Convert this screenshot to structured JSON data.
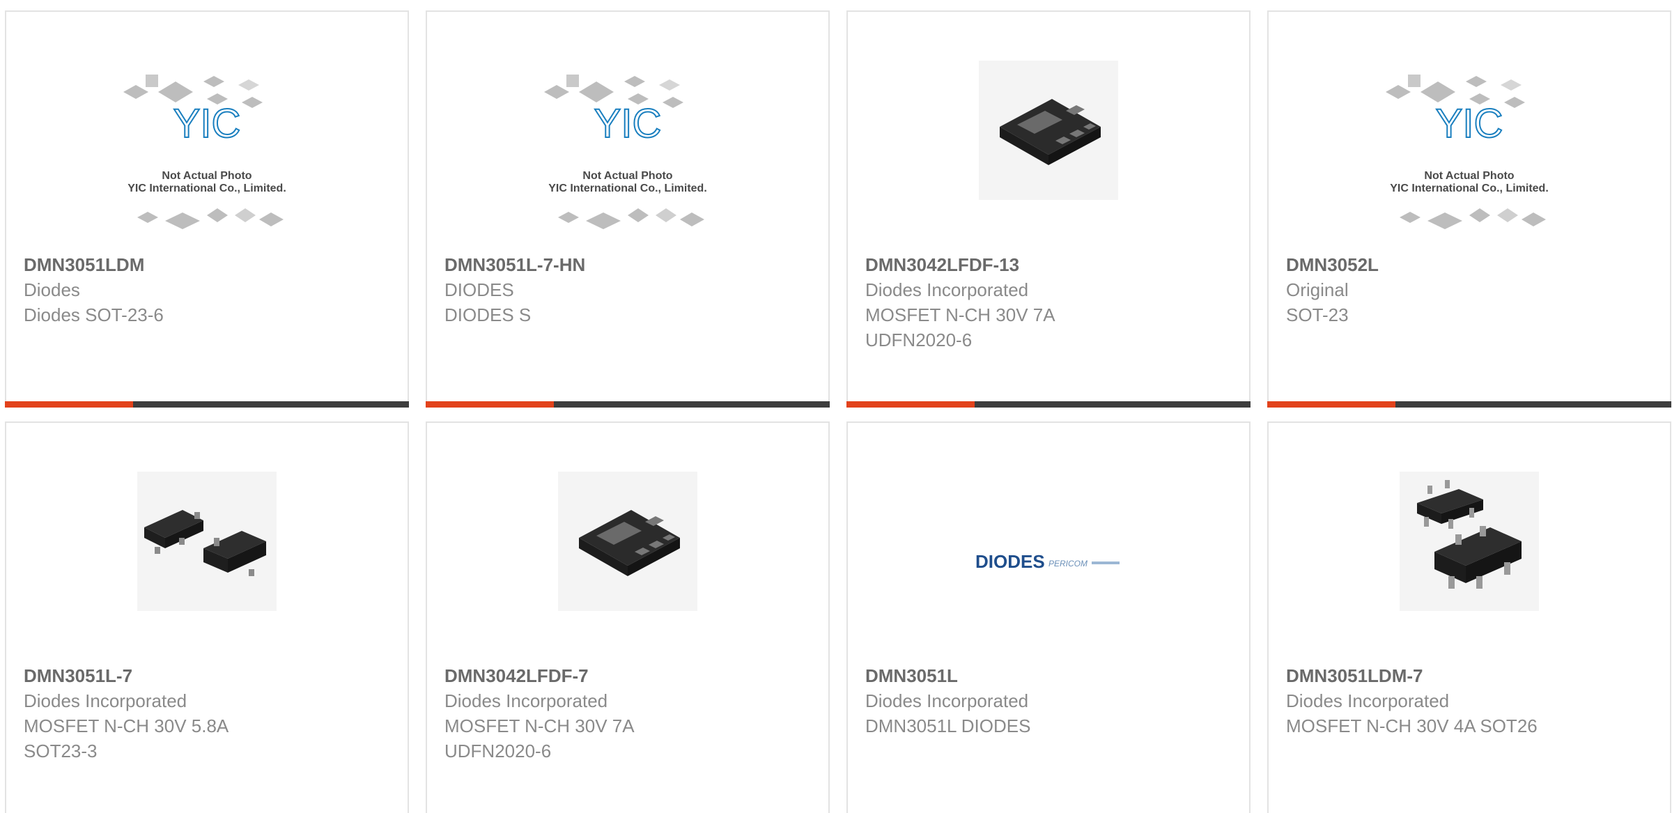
{
  "products": [
    {
      "part": "DMN3051LDM",
      "lines": [
        "Diodes",
        "Diodes SOT-23-6"
      ],
      "image": "placeholder-yic-logo"
    },
    {
      "part": "DMN3051L-7-HN",
      "lines": [
        "DIODES",
        "DIODES S"
      ],
      "image": "placeholder-yic-logo"
    },
    {
      "part": "DMN3042LFDF-13",
      "lines": [
        "Diodes Incorporated",
        "MOSFET N-CH 30V 7A",
        "UDFN2020-6"
      ],
      "image": "udfn-package-photo"
    },
    {
      "part": "DMN3052L",
      "lines": [
        "Original",
        "SOT-23"
      ],
      "image": "placeholder-yic-logo"
    },
    {
      "part": "DMN3051L-7",
      "lines": [
        "Diodes Incorporated",
        "MOSFET N-CH 30V 5.8A",
        "SOT23-3"
      ],
      "image": "sot23-package-photo"
    },
    {
      "part": "DMN3042LFDF-7",
      "lines": [
        "Diodes Incorporated",
        "MOSFET N-CH 30V 7A",
        "UDFN2020-6"
      ],
      "image": "udfn-package-photo"
    },
    {
      "part": "DMN3051L",
      "lines": [
        "Diodes Incorporated",
        "DMN3051L DIODES"
      ],
      "image": "diodes-pericom-logo"
    },
    {
      "part": "DMN3051LDM-7",
      "lines": [
        "Diodes Incorporated",
        "MOSFET N-CH 30V 4A SOT26"
      ],
      "image": "sot26-package-photo"
    }
  ],
  "placeholder": {
    "brand": "YIC",
    "caption_1": "Not Actual Photo",
    "caption_2": "YIC International Co., Limited."
  },
  "logo_text": {
    "diodes": "DIODES",
    "pericom": "PERICOM"
  },
  "colors": {
    "accent": "#e2421b",
    "bar": "#3d3d3d",
    "border": "#e3e3e3",
    "part_text": "#6a6a6a",
    "line_text": "#8a8a8a"
  }
}
